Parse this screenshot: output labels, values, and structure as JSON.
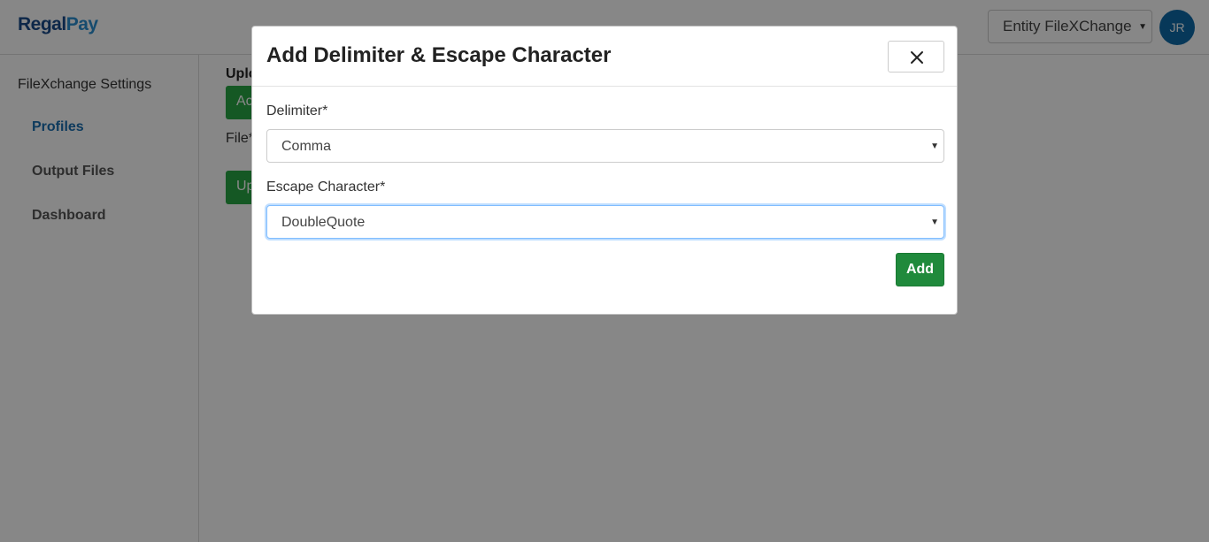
{
  "app": {
    "logo_part1": "Regal",
    "logo_part2": "Pay",
    "entity_select": "Entity FileXChange",
    "avatar_initials": "JR"
  },
  "sidebar": {
    "heading": "FileXchange Settings",
    "items": [
      {
        "label": "Profiles",
        "active": true
      },
      {
        "label": "Output Files",
        "active": false
      },
      {
        "label": "Dashboard",
        "active": false
      }
    ]
  },
  "background": {
    "upload_label": "Uplo",
    "add_button_partial": "Ac",
    "file_label": "File*",
    "upload_button_partial": "Up"
  },
  "modal": {
    "title": "Add Delimiter & Escape Character",
    "delimiter_label": "Delimiter*",
    "delimiter_value": "Comma",
    "escape_label": "Escape Character*",
    "escape_value": "DoubleQuote",
    "add_label": "Add"
  },
  "icons": {
    "close": "close-icon",
    "caret": "caret-down-icon"
  },
  "colors": {
    "primary_green": "#208a3c",
    "brand_blue": "#1a6fb0",
    "avatar_blue": "#0e6aa8",
    "focus_border": "#80bdff"
  }
}
